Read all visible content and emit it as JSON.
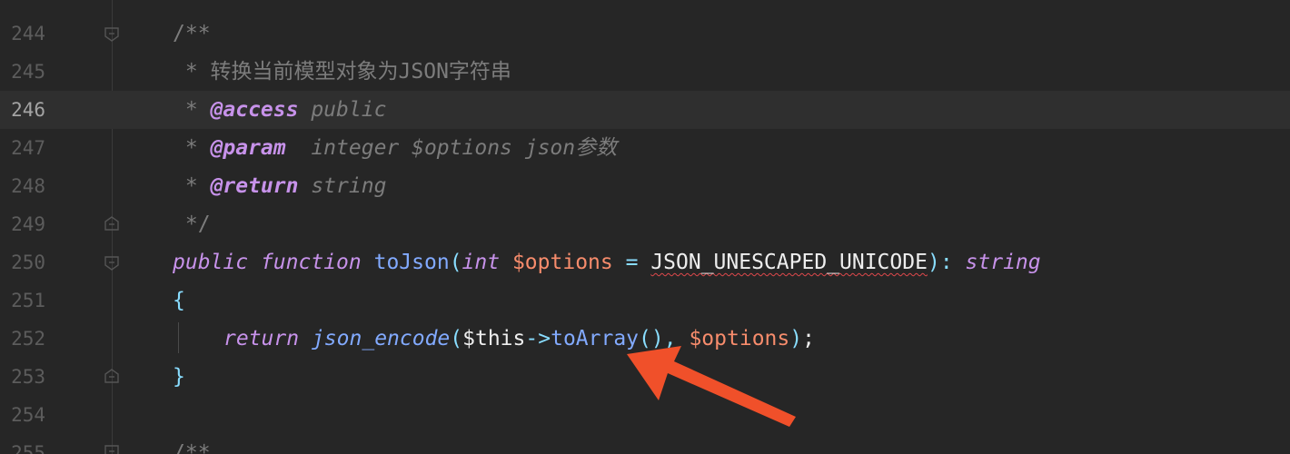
{
  "editor": {
    "lines": [
      {
        "number": "244",
        "text": "/**"
      },
      {
        "number": "245",
        "prefix": " * ",
        "text": "转换当前模型对象为JSON字符串"
      },
      {
        "number": "246",
        "prefix": " * ",
        "tag": "@access",
        "value": " public"
      },
      {
        "number": "247",
        "prefix": " * ",
        "tag": "@param",
        "value": "  integer $options json参数"
      },
      {
        "number": "248",
        "prefix": " * ",
        "tag": "@return",
        "value": " string"
      },
      {
        "number": "249",
        "text": " */"
      },
      {
        "number": "250",
        "kw_public": "public",
        "kw_function": "function",
        "fn_name": "toJson",
        "paren_open": "(",
        "type_int": "int",
        "param_var": "$options",
        "eq": "=",
        "constant": "JSON_UNESCAPED_UNICODE",
        "paren_close": ")",
        "colon": ":",
        "ret_type": "string"
      },
      {
        "number": "251",
        "text": "{"
      },
      {
        "number": "252",
        "kw_return": "return",
        "call": "json_encode",
        "p_open": "(",
        "this": "$this",
        "arrow": "->",
        "method": "toArray",
        "empty_parens": "()",
        "comma": ",",
        "arg": "$options",
        "p_close": ")",
        "semi": ";"
      },
      {
        "number": "253",
        "text": "}"
      },
      {
        "number": "254",
        "text": ""
      },
      {
        "number": "255",
        "text": "/**"
      }
    ],
    "current_line": "246"
  },
  "annotation": {
    "type": "arrow",
    "color": "#f0502a",
    "target": "toArray"
  }
}
